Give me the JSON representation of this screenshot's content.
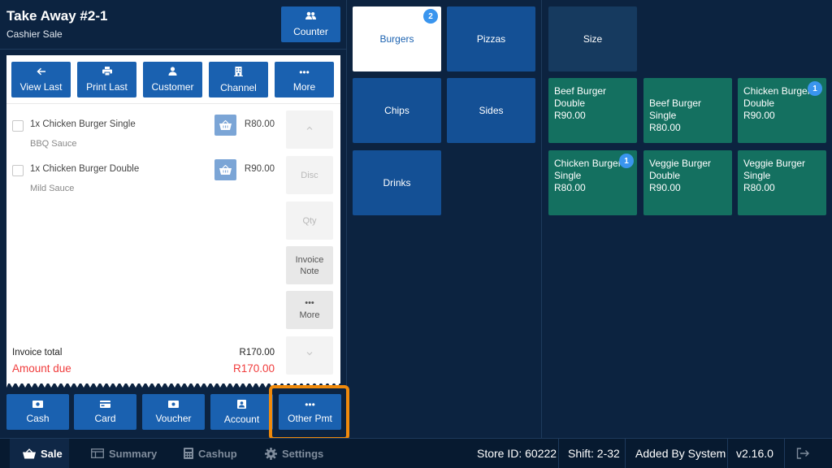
{
  "header": {
    "title": "Take Away #2-1",
    "subtitle": "Cashier Sale",
    "counter_label": "Counter"
  },
  "toolbar": [
    {
      "label": "View Last",
      "icon": "arrow-left-icon"
    },
    {
      "label": "Print Last",
      "icon": "printer-icon"
    },
    {
      "label": "Customer",
      "icon": "person-icon"
    },
    {
      "label": "Channel",
      "icon": "building-icon"
    },
    {
      "label": "More",
      "icon": "ellipsis-icon"
    }
  ],
  "items": [
    {
      "name": "1x Chicken Burger Single",
      "modifier": "BBQ Sauce",
      "price": "R80.00"
    },
    {
      "name": "1x Chicken Burger Double",
      "modifier": "Mild Sauce",
      "price": "R90.00"
    }
  ],
  "side_actions": {
    "disc": "Disc",
    "qty": "Qty",
    "invoice_note_1": "Invoice",
    "invoice_note_2": "Note",
    "more": "More"
  },
  "totals": {
    "invoice_total_label": "Invoice total",
    "invoice_total": "R170.00",
    "amount_due_label": "Amount due",
    "amount_due": "R170.00"
  },
  "payments": [
    {
      "label": "Cash",
      "icon": "cash-icon"
    },
    {
      "label": "Card",
      "icon": "card-icon"
    },
    {
      "label": "Voucher",
      "icon": "voucher-icon"
    },
    {
      "label": "Account",
      "icon": "account-icon"
    },
    {
      "label": "Other Pmt",
      "icon": "ellipsis-icon"
    }
  ],
  "categories": [
    {
      "label": "Burgers",
      "badge": "2",
      "selected": true
    },
    {
      "label": "Pizzas"
    },
    {
      "label": "Chips"
    },
    {
      "label": "Sides"
    },
    {
      "label": "Drinks"
    }
  ],
  "size_label": "Size",
  "products": [
    {
      "line1": "Beef Burger",
      "line2": "Double",
      "price": "R90.00"
    },
    {
      "line1": "Beef Burger Single",
      "line2": "",
      "price": "R80.00"
    },
    {
      "line1": "Chicken Burger",
      "line2": "Double",
      "price": "R90.00",
      "badge": "1"
    },
    {
      "line1": "Chicken Burger",
      "line2": "Single",
      "price": "R80.00",
      "badge": "1"
    },
    {
      "line1": "Veggie Burger",
      "line2": "Double",
      "price": "R90.00"
    },
    {
      "line1": "Veggie Burger",
      "line2": "Single",
      "price": "R80.00"
    }
  ],
  "bottom_nav": [
    {
      "label": "Sale",
      "icon": "basket-icon",
      "active": true
    },
    {
      "label": "Summary",
      "icon": "table-icon"
    },
    {
      "label": "Cashup",
      "icon": "calculator-icon"
    },
    {
      "label": "Settings",
      "icon": "gear-icon"
    }
  ],
  "status": {
    "store_id": "Store ID: 60222",
    "shift": "Shift: 2-32",
    "added_by": "Added By System",
    "version": "v2.16.0"
  },
  "colors": {
    "background": "#0c2340",
    "button": "#1a61b0",
    "category": "#145095",
    "product": "#147060",
    "alert": "#f03c3c",
    "highlight": "#f08a0b",
    "badge": "#3a95ee"
  }
}
